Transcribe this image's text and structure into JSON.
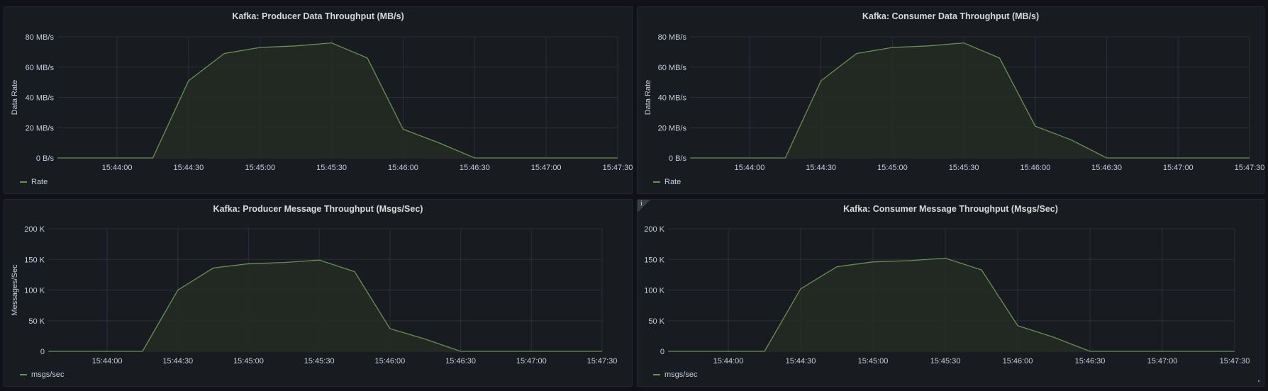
{
  "colors": {
    "series_line": "#6b8f5a",
    "series_fill": "#252b24",
    "grid": "#2c2f35",
    "axis_text": "#c7d0d9",
    "panel_bg": "#181b1f"
  },
  "info_icon_glyph": "i",
  "chart_data": [
    {
      "type": "area",
      "title": "Kafka: Producer Data Throughput (MB/s)",
      "ylabel": "Data Rate",
      "xlabel": "",
      "x_ticks": [
        "15:44:00",
        "15:44:30",
        "15:45:00",
        "15:45:30",
        "15:46:00",
        "15:46:30",
        "15:47:00",
        "15:47:30"
      ],
      "y_ticks": [
        "0 B/s",
        "20 MB/s",
        "40 MB/s",
        "60 MB/s",
        "80 MB/s"
      ],
      "ylim": [
        0,
        80
      ],
      "grid": true,
      "legend_position": "bottom-left",
      "series": [
        {
          "name": "Rate",
          "x": [
            "15:43:35",
            "15:43:45",
            "15:43:55",
            "15:44:05",
            "15:44:15",
            "15:44:30",
            "15:44:45",
            "15:45:00",
            "15:45:15",
            "15:45:30",
            "15:45:45",
            "15:46:00",
            "15:46:15",
            "15:46:30",
            "15:46:45",
            "15:47:00",
            "15:47:15",
            "15:47:30"
          ],
          "values": [
            0,
            0,
            0,
            0,
            0,
            51,
            69,
            73,
            74,
            76,
            66,
            19,
            10,
            0,
            0,
            0,
            0,
            0
          ]
        }
      ]
    },
    {
      "type": "area",
      "title": "Kafka: Consumer Data Throughput (MB/s)",
      "ylabel": "Data Rate",
      "xlabel": "",
      "x_ticks": [
        "15:44:00",
        "15:44:30",
        "15:45:00",
        "15:45:30",
        "15:46:00",
        "15:46:30",
        "15:47:00",
        "15:47:30"
      ],
      "y_ticks": [
        "0 B/s",
        "20 MB/s",
        "40 MB/s",
        "60 MB/s",
        "80 MB/s"
      ],
      "ylim": [
        0,
        80
      ],
      "grid": true,
      "legend_position": "bottom-left",
      "series": [
        {
          "name": "Rate",
          "x": [
            "15:43:35",
            "15:43:45",
            "15:43:55",
            "15:44:05",
            "15:44:15",
            "15:44:30",
            "15:44:45",
            "15:45:00",
            "15:45:15",
            "15:45:30",
            "15:45:45",
            "15:46:00",
            "15:46:15",
            "15:46:30",
            "15:46:45",
            "15:47:00",
            "15:47:15",
            "15:47:30"
          ],
          "values": [
            0,
            0,
            0,
            0,
            0,
            51,
            69,
            73,
            74,
            76,
            66,
            21,
            12,
            0,
            0,
            0,
            0,
            0
          ]
        }
      ]
    },
    {
      "type": "area",
      "title": "Kafka: Producer Message Throughput (Msgs/Sec)",
      "ylabel": "Messages/Sec",
      "xlabel": "",
      "x_ticks": [
        "15:44:00",
        "15:44:30",
        "15:45:00",
        "15:45:30",
        "15:46:00",
        "15:46:30",
        "15:47:00",
        "15:47:30"
      ],
      "y_ticks": [
        "0",
        "50 K",
        "100 K",
        "150 K",
        "200 K"
      ],
      "ylim": [
        0,
        200
      ],
      "grid": true,
      "legend_position": "bottom-left",
      "series": [
        {
          "name": "msgs/sec",
          "x": [
            "15:43:35",
            "15:43:45",
            "15:43:55",
            "15:44:05",
            "15:44:15",
            "15:44:30",
            "15:44:45",
            "15:45:00",
            "15:45:15",
            "15:45:30",
            "15:45:45",
            "15:46:00",
            "15:46:15",
            "15:46:30",
            "15:46:45",
            "15:47:00",
            "15:47:15",
            "15:47:30"
          ],
          "values": [
            0,
            0,
            0,
            0,
            0,
            100,
            136,
            143,
            145,
            149,
            130,
            37,
            20,
            0,
            0,
            0,
            0,
            0
          ]
        }
      ]
    },
    {
      "type": "area",
      "title": "Kafka: Consumer Message Throughput (Msgs/Sec)",
      "ylabel": "",
      "xlabel": "",
      "x_ticks": [
        "15:44:00",
        "15:44:30",
        "15:45:00",
        "15:45:30",
        "15:46:00",
        "15:46:30",
        "15:47:00",
        "15:47:30"
      ],
      "y_ticks": [
        "0",
        "50 K",
        "100 K",
        "150 K",
        "200 K"
      ],
      "ylim": [
        0,
        200
      ],
      "grid": true,
      "legend_position": "bottom-left",
      "series": [
        {
          "name": "msgs/sec",
          "x": [
            "15:43:35",
            "15:43:45",
            "15:43:55",
            "15:44:05",
            "15:44:15",
            "15:44:30",
            "15:44:45",
            "15:45:00",
            "15:45:15",
            "15:45:30",
            "15:45:45",
            "15:46:00",
            "15:46:15",
            "15:46:30",
            "15:46:45",
            "15:47:00",
            "15:47:15",
            "15:47:30"
          ],
          "values": [
            0,
            0,
            0,
            0,
            0,
            102,
            138,
            146,
            148,
            152,
            133,
            42,
            23,
            0,
            0,
            0,
            0,
            0
          ]
        }
      ]
    }
  ]
}
